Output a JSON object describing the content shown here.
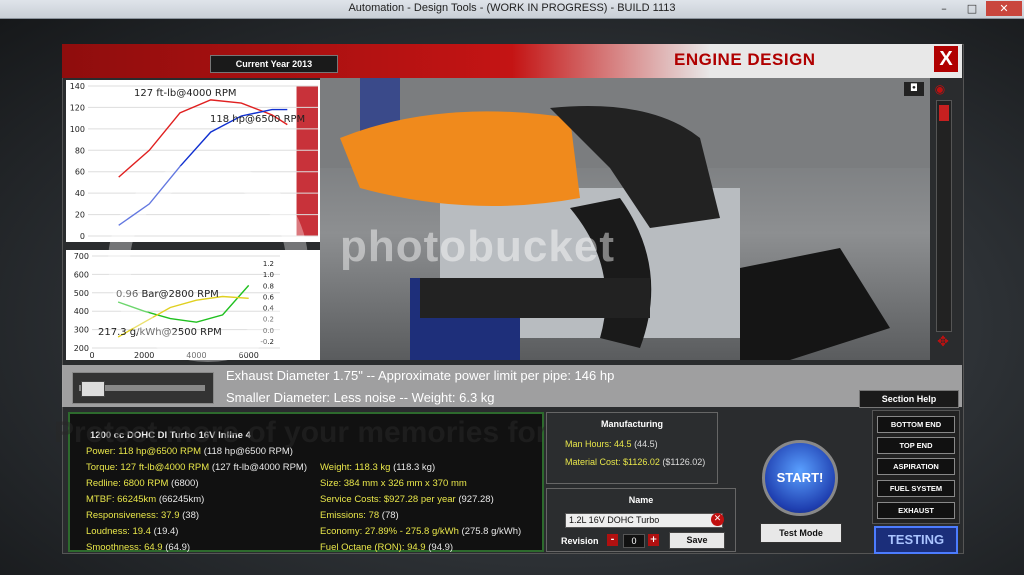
{
  "window": {
    "title": "Automation - Design Tools - (WORK IN PROGRESS) - BUILD 1113",
    "min": "–",
    "max": "□",
    "close": "✕"
  },
  "header": {
    "current_year": "Current Year 2013",
    "title": "ENGINE DESIGN",
    "close": "X"
  },
  "chart_data": [
    {
      "type": "line",
      "title": "",
      "x": [
        0,
        1000,
        2000,
        3000,
        4000,
        5000,
        6000,
        6500
      ],
      "ylim": [
        0,
        140
      ],
      "yticks": [
        "140",
        "120",
        "100",
        "80",
        "60",
        "40",
        "20",
        "0"
      ],
      "series": [
        {
          "name": "",
          "color": "#e02020",
          "values": [
            null,
            55,
            80,
            115,
            127,
            124,
            113,
            104
          ]
        },
        {
          "name": "",
          "color": "#1030d0",
          "values": [
            null,
            10,
            30,
            65,
            97,
            112,
            118,
            118
          ]
        }
      ],
      "annotations": [
        "127 ft-lb@4000 RPM",
        "118 hp@6500 RPM"
      ],
      "redline_from": 6800
    },
    {
      "type": "line",
      "title": "",
      "x": [
        0,
        1000,
        2000,
        3000,
        4000,
        5000,
        6000
      ],
      "xticks": [
        "0",
        "2000",
        "4000",
        "6000"
      ],
      "ylim": [
        200,
        700
      ],
      "yticks": [
        "700",
        "600",
        "500",
        "400",
        "300",
        "200"
      ],
      "y2ticks": [
        "1.2",
        "1.0",
        "0.8",
        "0.6",
        "0.4",
        "0.2",
        "0.0",
        "-0.2"
      ],
      "series": [
        {
          "name": "",
          "color": "#20c020",
          "values": [
            null,
            450,
            400,
            360,
            340,
            380,
            540
          ]
        },
        {
          "name": "",
          "color": "#e0d020",
          "values": [
            null,
            260,
            340,
            420,
            460,
            480,
            470
          ]
        }
      ],
      "annotations": [
        "0.96 Bar@2800 RPM",
        "217.3 g/kWh@2500 RPM"
      ]
    }
  ],
  "info": {
    "line1": "Exhaust Diameter 1.75\" -- Approximate power limit per pipe: 146 hp",
    "line2": "Smaller Diameter: Less noise -- Weight: 6.3 kg",
    "section_help": "Section Help"
  },
  "stats": {
    "title": "1200 cc DOHC DI Turbo 16V Inline 4",
    "left": [
      {
        "label": "Power: 118 hp@6500 RPM",
        "value": "(118 hp@6500 RPM)"
      },
      {
        "label": "Torque: 127 ft-lb@4000 RPM",
        "value": "(127 ft-lb@4000 RPM)"
      },
      {
        "label": "Redline: 6800 RPM",
        "value": "(6800)"
      },
      {
        "label": "MTBF: 66245km",
        "value": "(66245km)"
      },
      {
        "label": "Responsiveness: 37.9",
        "value": "(38)"
      },
      {
        "label": "Loudness: 19.4",
        "value": "(19.4)"
      },
      {
        "label": "Smoothness: 64.9",
        "value": "(64.9)"
      }
    ],
    "right": [
      {
        "label": "Weight: 118.3 kg",
        "value": "(118.3 kg)"
      },
      {
        "label": "Size: 384 mm x 326 mm x 370 mm",
        "value": ""
      },
      {
        "label": "Service Costs: $927.28 per year",
        "value": "(927.28)"
      },
      {
        "label": "Emissions: 78",
        "value": "(78)"
      },
      {
        "label": "Economy: 27.89% - 275.8 g/kWh",
        "value": "(275.8 g/kWh)"
      },
      {
        "label": "Fuel Octane (RON): 94.9",
        "value": "(94.9)"
      }
    ]
  },
  "manufacturing": {
    "title": "Manufacturing",
    "hours_label": "Man Hours: 44.5",
    "hours_value": "(44.5)",
    "cost_label": "Material Cost: $1126.02",
    "cost_value": "($1126.02)"
  },
  "name": {
    "title": "Name",
    "value": "1.2L 16V DOHC Turbo",
    "revision_label": "Revision",
    "revision": "0",
    "minus": "-",
    "plus": "+",
    "save": "Save"
  },
  "start": "START!",
  "test_mode": "Test Mode",
  "tabs": [
    "BOTTOM END",
    "TOP END",
    "ASPIRATION",
    "FUEL SYSTEM",
    "EXHAUST"
  ],
  "testing": "TESTING",
  "watermark": "photobucket",
  "promo": "Protect more of your memories for less!"
}
